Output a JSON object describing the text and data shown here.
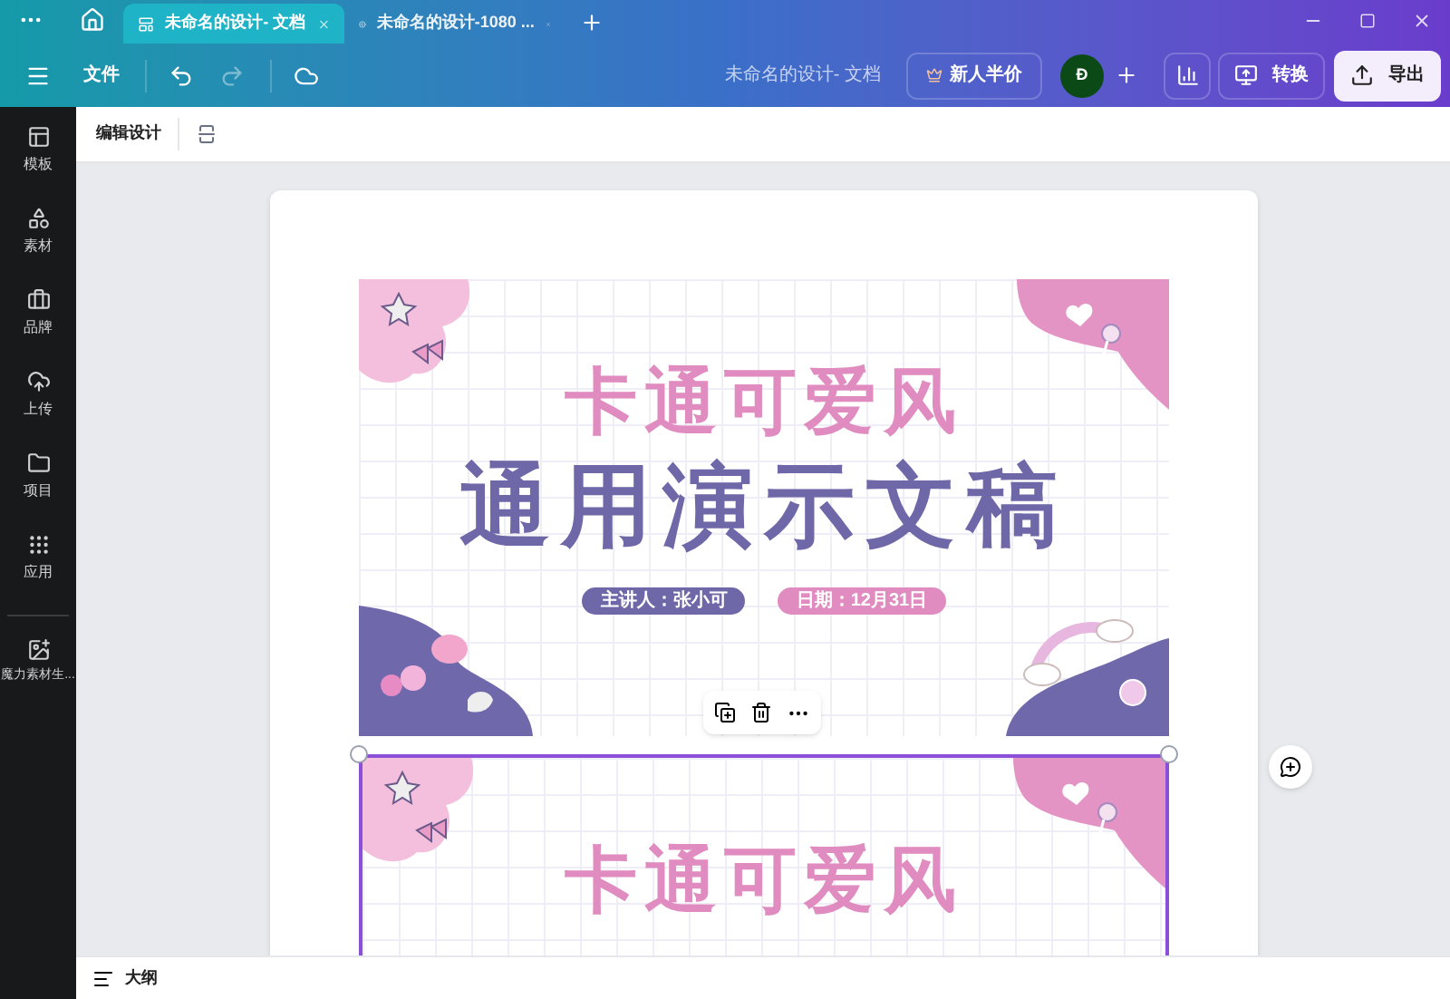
{
  "tabs": [
    {
      "label": "未命名的设计- 文档",
      "selected": true
    },
    {
      "label": "未命名的设计-1080 ...",
      "selected": false
    }
  ],
  "toolbar": {
    "file_menu": "文件",
    "doc_title": "未命名的设计- 文档",
    "promo": "新人半价",
    "avatar": "Đ",
    "convert": "转换",
    "export": "导出"
  },
  "subtoolbar": {
    "label": "编辑设计"
  },
  "sidebar": {
    "items": [
      {
        "label": "模板"
      },
      {
        "label": "素材"
      },
      {
        "label": "品牌"
      },
      {
        "label": "上传"
      },
      {
        "label": "项目"
      },
      {
        "label": "应用"
      }
    ],
    "extra": {
      "label": "魔力素材生..."
    }
  },
  "slides": [
    {
      "title": "卡通可爱风",
      "subtitle": "通用演示文稿",
      "presenter": "主讲人：张小可",
      "date": "日期：12月31日",
      "selected": false
    },
    {
      "title": "卡通可爱风",
      "selected": true
    }
  ],
  "bottom_bar": {
    "outline": "大纲"
  }
}
